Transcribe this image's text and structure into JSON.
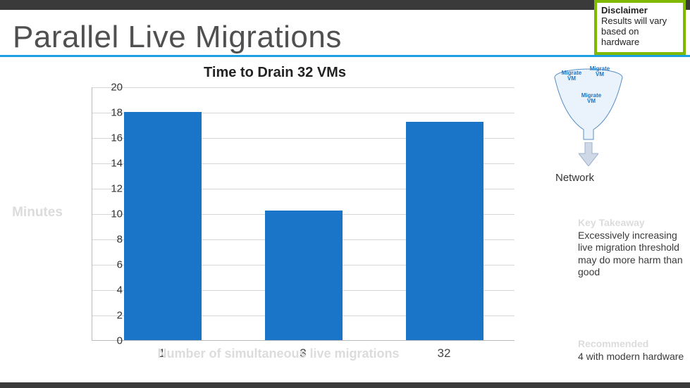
{
  "title": "Parallel Live Migrations",
  "disclaimer": {
    "heading": "Disclaimer",
    "body": "Results will vary based on hardware"
  },
  "funnel": {
    "vm1": "Migrate VM",
    "vm2": "Migrate VM",
    "vm3": "Migrate VM",
    "network": "Network"
  },
  "takeaway": {
    "heading": "Key Takeaway",
    "body": "Excessively increasing live migration threshold may do more harm than good"
  },
  "recommended": {
    "heading": "Recommended",
    "body": "4 with modern hardware"
  },
  "chart_data": {
    "type": "bar",
    "title": "Time to Drain 32 VMs",
    "xlabel": "Number of simultaneous live migrations",
    "ylabel": "Minutes",
    "ylim": [
      0,
      20
    ],
    "yticks": [
      0,
      2,
      4,
      6,
      8,
      10,
      12,
      14,
      16,
      18,
      20
    ],
    "categories": [
      "1",
      "3",
      "32"
    ],
    "values": [
      18,
      10.2,
      17.2
    ]
  }
}
